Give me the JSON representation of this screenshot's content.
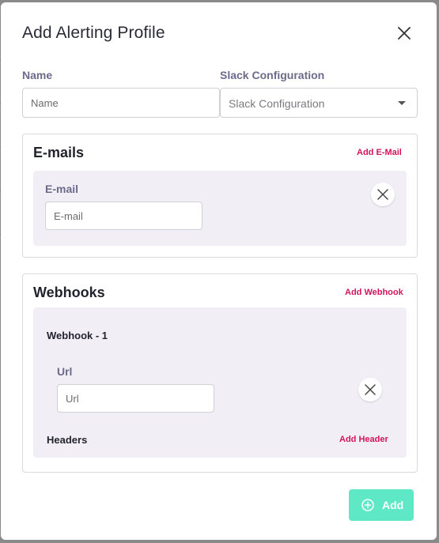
{
  "dialog": {
    "title": "Add Alerting Profile"
  },
  "name_field": {
    "label": "Name",
    "placeholder": "Name",
    "value": ""
  },
  "slack_field": {
    "label": "Slack Configuration",
    "placeholder": "Slack Configuration"
  },
  "emails": {
    "title": "E-mails",
    "add_label": "Add E-Mail",
    "items": [
      {
        "label": "E-mail",
        "placeholder": "E-mail",
        "value": ""
      }
    ]
  },
  "webhooks": {
    "title": "Webhooks",
    "add_label": "Add Webhook",
    "items": [
      {
        "title": "Webhook - 1",
        "url_label": "Url",
        "url_placeholder": "Url",
        "url_value": "",
        "headers_label": "Headers",
        "add_header_label": "Add Header"
      }
    ]
  },
  "footer": {
    "submit_label": "Add"
  },
  "icons": {
    "close": "close-icon",
    "remove": "close-icon",
    "add": "plus-circle-icon"
  },
  "colors": {
    "accent_link": "#d4145a",
    "submit_bg": "#5ee8c5",
    "label": "#6c6a8a",
    "panel_bg": "#f1eff5"
  }
}
